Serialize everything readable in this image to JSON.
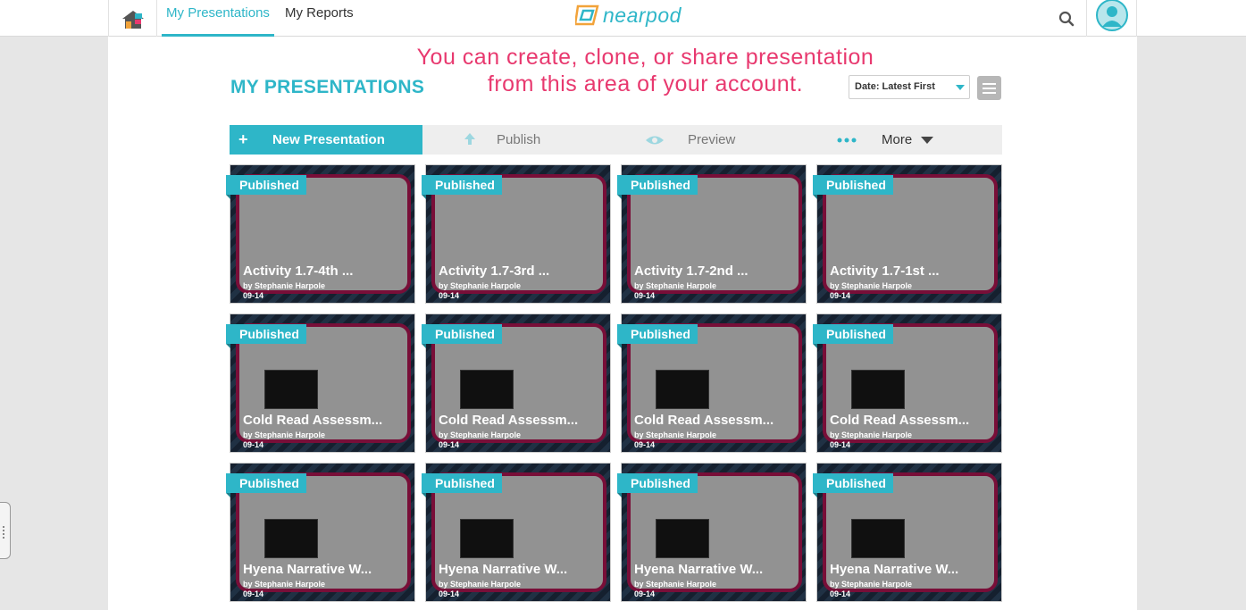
{
  "nav": {
    "tabs": [
      {
        "label": "My Presentations",
        "active": true
      },
      {
        "label": "My Reports",
        "active": false
      }
    ],
    "logo_text": "nearpod",
    "icons": {
      "home": "home-icon",
      "search": "search-icon",
      "avatar": "user-avatar-icon"
    }
  },
  "annotation": {
    "line1": "You can create, clone, or share presentation",
    "line2": "from this area of your account."
  },
  "page_title": "MY PRESENTATIONS",
  "sort": {
    "selected": "Date: Latest First"
  },
  "actions": {
    "new_presentation": "New Presentation",
    "publish": "Publish",
    "preview": "Preview",
    "more": "More"
  },
  "colors": {
    "accent": "#2eb6c8",
    "annotation": "#e8396f"
  },
  "cards": [
    {
      "badge": "Published",
      "title": "Activity 1.7-4th ...",
      "author": "by Stephanie Harpole",
      "date": "09-14",
      "theme": "narratives"
    },
    {
      "badge": "Published",
      "title": "Activity 1.7-3rd ...",
      "author": "by Stephanie Harpole",
      "date": "09-14",
      "theme": "narratives"
    },
    {
      "badge": "Published",
      "title": "Activity 1.7-2nd ...",
      "author": "by Stephanie Harpole",
      "date": "09-14",
      "theme": "narratives"
    },
    {
      "badge": "Published",
      "title": "Activity 1.7-1st ...",
      "author": "by Stephanie Harpole",
      "date": "09-14",
      "theme": "narratives"
    },
    {
      "badge": "Published",
      "title": "Cold Read Assessm...",
      "author": "by Stephanie Harpole",
      "date": "09-14",
      "theme": "characterization"
    },
    {
      "badge": "Published",
      "title": "Cold Read Assessm...",
      "author": "by Stephanie Harpole",
      "date": "09-14",
      "theme": "characterization"
    },
    {
      "badge": "Published",
      "title": "Cold Read Assessm...",
      "author": "by Stephanie Harpole",
      "date": "09-14",
      "theme": "characterization"
    },
    {
      "badge": "Published",
      "title": "Cold Read Assessm...",
      "author": "by Stephanie Harpole",
      "date": "09-14",
      "theme": "characterization"
    },
    {
      "badge": "Published",
      "title": "Hyena Narrative W...",
      "author": "by Stephanie Harpole",
      "date": "09-14",
      "theme": "characterization"
    },
    {
      "badge": "Published",
      "title": "Hyena Narrative W...",
      "author": "by Stephanie Harpole",
      "date": "09-14",
      "theme": "characterization"
    },
    {
      "badge": "Published",
      "title": "Hyena Narrative W...",
      "author": "by Stephanie Harpole",
      "date": "09-14",
      "theme": "characterization"
    },
    {
      "badge": "Published",
      "title": "Hyena Narrative W...",
      "author": "by Stephanie Harpole",
      "date": "09-14",
      "theme": "characterization"
    }
  ]
}
